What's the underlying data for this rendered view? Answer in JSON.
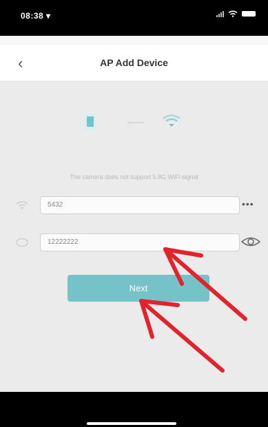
{
  "status_bar": {
    "time": "08:38 ▾"
  },
  "nav": {
    "back_symbol": "‹",
    "title": "AP Add Device"
  },
  "content": {
    "notice": "The camera does not support 5.8G WiFi signal",
    "ssid": {
      "value": "5432"
    },
    "password": {
      "value": "12222222"
    },
    "next_label": "Next"
  },
  "colors": {
    "accent": "#75c2c8",
    "annotation": "#e1232b"
  },
  "icons": [
    "phone-icon",
    "wifi-icon",
    "lock-icon",
    "eye-icon",
    "more-icon",
    "back-icon"
  ]
}
